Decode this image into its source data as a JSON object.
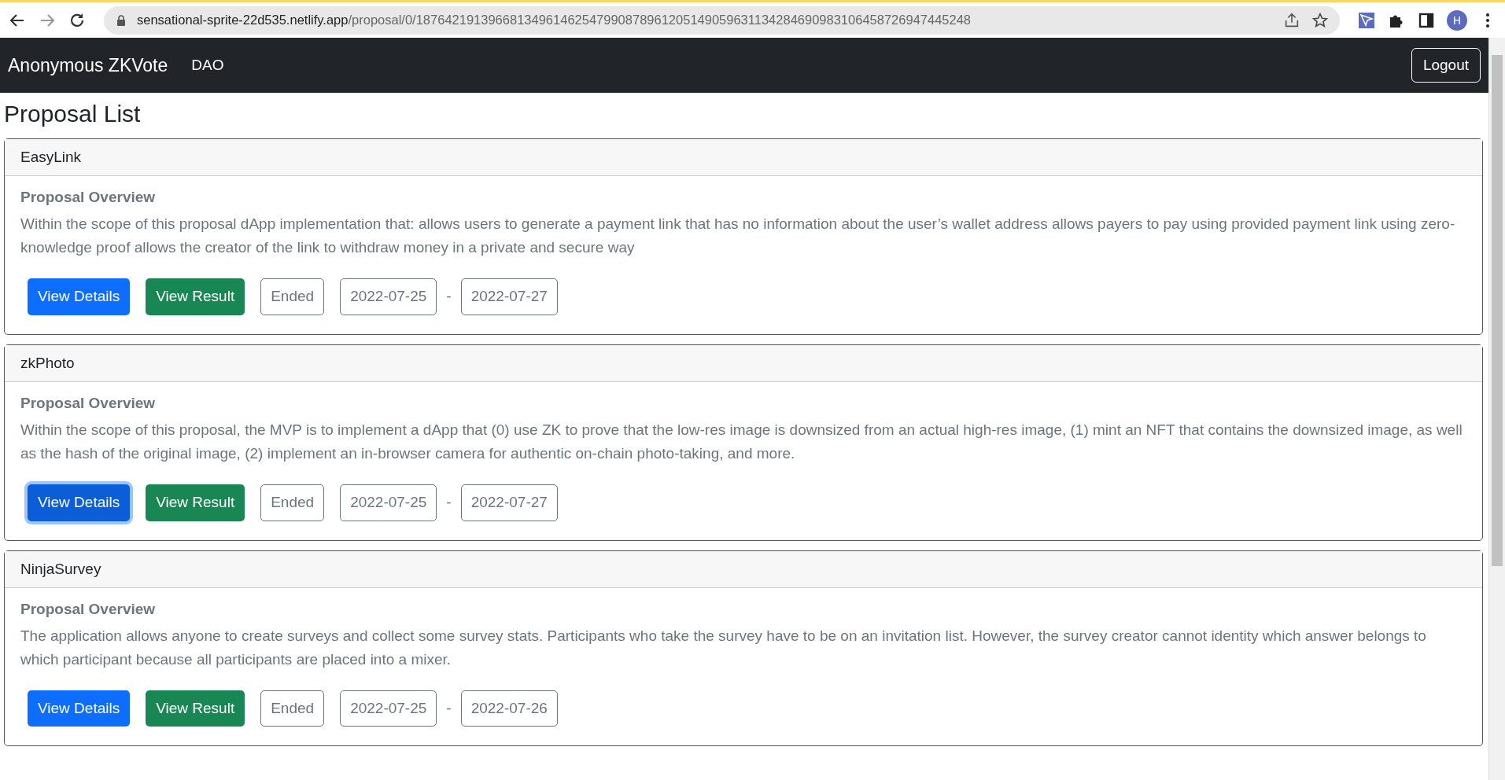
{
  "browser": {
    "url_host": "sensational-sprite-22d535.netlify.app",
    "url_path": "/proposal/0/18764219139668134961462547990878961205149059631134284690983106458726947445248",
    "profile_initial": "H"
  },
  "navbar": {
    "brand": "Anonymous ZKVote",
    "links": [
      "DAO"
    ],
    "logout": "Logout"
  },
  "page_title": "Proposal List",
  "proposals": [
    {
      "name": "EasyLink",
      "overview_heading": "Proposal Overview",
      "description": "Within the scope of this proposal dApp implementation that: allows users to generate a payment link that has no information about the user’s wallet address allows payers to pay using provided payment link using zero-knowledge proof allows the creator of the link to withdraw money in a private and secure way",
      "details_button": "View Details",
      "details_focused": false,
      "result_button": "View Result",
      "status": "Ended",
      "start_date": "2022-07-25",
      "separator": "-",
      "end_date": "2022-07-27"
    },
    {
      "name": "zkPhoto",
      "overview_heading": "Proposal Overview",
      "description": "Within the scope of this proposal, the MVP is to implement a dApp that (0) use ZK to prove that the low-res image is downsized from an actual high-res image, (1) mint an NFT that contains the downsized image, as well as the hash of the original image, (2) implement an in-browser camera for authentic on-chain photo-taking, and more.",
      "details_button": "View Details",
      "details_focused": true,
      "result_button": "View Result",
      "status": "Ended",
      "start_date": "2022-07-25",
      "separator": "-",
      "end_date": "2022-07-27"
    },
    {
      "name": "NinjaSurvey",
      "overview_heading": "Proposal Overview",
      "description": "The application allows anyone to create surveys and collect some survey stats. Participants who take the survey have to be on an invitation list. However, the survey creator cannot identity which answer belongs to which participant because all participants are placed into a mixer.",
      "details_button": "View Details",
      "details_focused": false,
      "result_button": "View Result",
      "status": "Ended",
      "start_date": "2022-07-25",
      "separator": "-",
      "end_date": "2022-07-26"
    }
  ]
}
